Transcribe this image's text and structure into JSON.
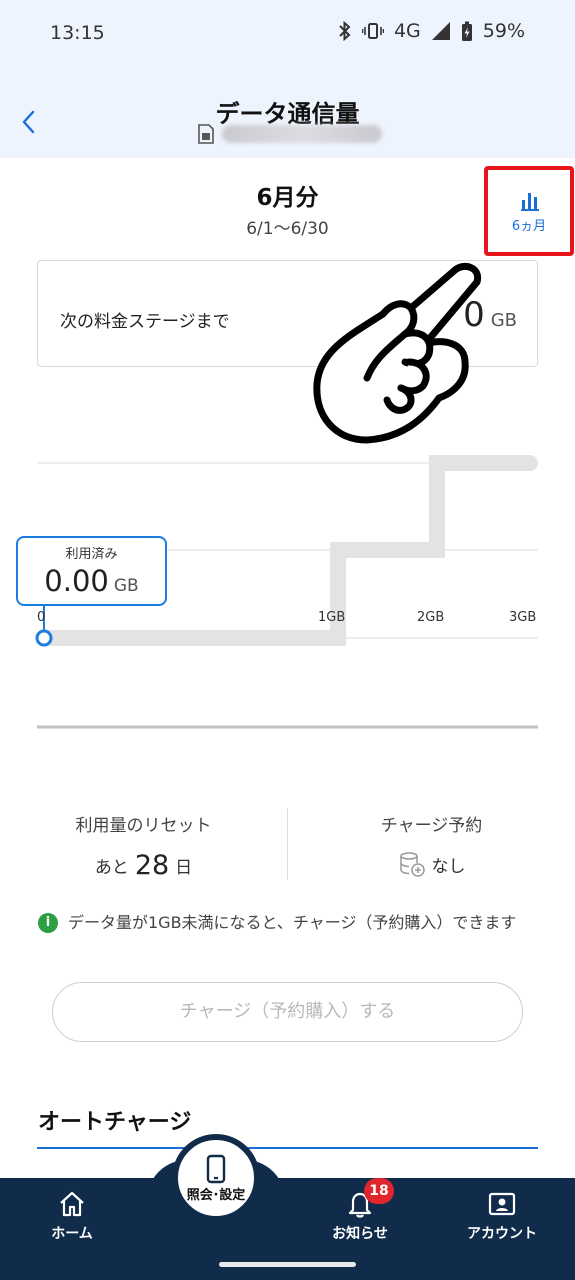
{
  "status_bar": {
    "time": "13:15",
    "network": "4G",
    "battery": "59%"
  },
  "header": {
    "title": "データ通信量"
  },
  "period": {
    "title": "6月分",
    "range": "6/1〜6/30"
  },
  "six_month_button": {
    "label": "6ヵ月"
  },
  "stage": {
    "label": "次の料金ステージまで",
    "value": "0",
    "unit": "GB"
  },
  "usage": {
    "used_title": "利用済み",
    "used_value": "0.00",
    "used_unit": "GB",
    "axis_labels": [
      "0",
      "1GB",
      "2GB",
      "3GB"
    ],
    "used_gb": 0,
    "max_gb": 3
  },
  "reset": {
    "title": "利用量のリセット",
    "prefix": "あと",
    "days": "28",
    "suffix": "日"
  },
  "charge_reservation": {
    "title": "チャージ予約",
    "value": "なし"
  },
  "info": {
    "icon": "i",
    "text": "データ量が1GB未満になると、チャージ（予約購入）できます"
  },
  "charge_button": {
    "label": "チャージ（予約購入）する"
  },
  "auto_charge": {
    "title": "オートチャージ"
  },
  "bottom_nav": {
    "home": "ホーム",
    "settings": "照会･設定",
    "notices": "お知らせ",
    "notices_badge": "18",
    "account": "アカウント"
  },
  "colors": {
    "accent": "#1a6fd6",
    "highlight": "#e8141c",
    "nav_bg": "#112b4a",
    "badge": "#e0252c",
    "info": "#2ea043"
  }
}
